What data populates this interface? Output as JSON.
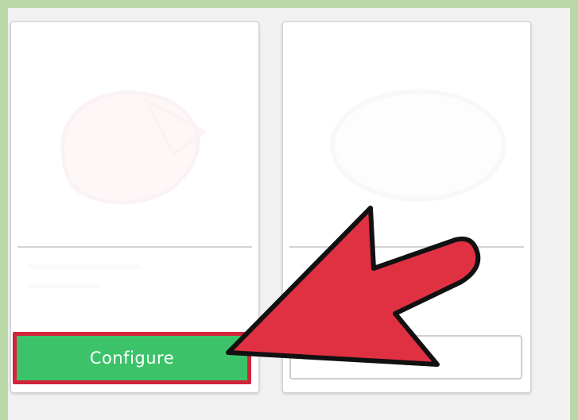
{
  "cards": [
    {
      "button_label": "Configure",
      "preview_icon": "device-outline-icon"
    },
    {
      "button_label": "",
      "preview_icon": "oval-outline-icon"
    }
  ],
  "annotation": {
    "pointer_icon": "pointer-arrow-icon",
    "highlight_color": "#d2243c",
    "arrow_color": "#e03143"
  },
  "colors": {
    "frame": "#b9d7a7",
    "background": "#f1f1f1",
    "configure_button": "#3cc36a"
  }
}
